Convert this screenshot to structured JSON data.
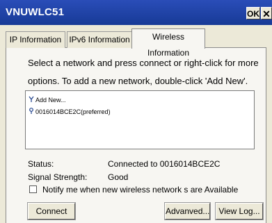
{
  "window": {
    "title": "VNUWLC51",
    "ok_label": "OK",
    "close_label": "✕"
  },
  "tabs": [
    {
      "label": "IP Information"
    },
    {
      "label": "IPv6 Information"
    },
    {
      "label": "Wireless Information"
    }
  ],
  "active_tab": "Wireless Information",
  "instructions": {
    "line1": "Select a network and press connect or right-click for more",
    "line2": "options. To add a new network, double-click 'Add New'."
  },
  "networks": [
    {
      "label": "Add New...",
      "icon": "antenna-icon"
    },
    {
      "label": "0016014BCE2C(preferred)",
      "icon": "access-point-icon"
    }
  ],
  "status": {
    "status_label": "Status:",
    "status_value": "Connected to 0016014BCE2C",
    "signal_label": "Signal Strength:",
    "signal_value": "Good"
  },
  "notify": {
    "label": "Notify me when new wireless network s are Available",
    "checked": false
  },
  "buttons": {
    "connect": "Connect",
    "advanced": "Advanved...",
    "view_log": "View Log..."
  },
  "colors": {
    "titlebar": "#1f3fa0",
    "dialog": "#ece9d8",
    "panel": "#f7f6f2"
  }
}
